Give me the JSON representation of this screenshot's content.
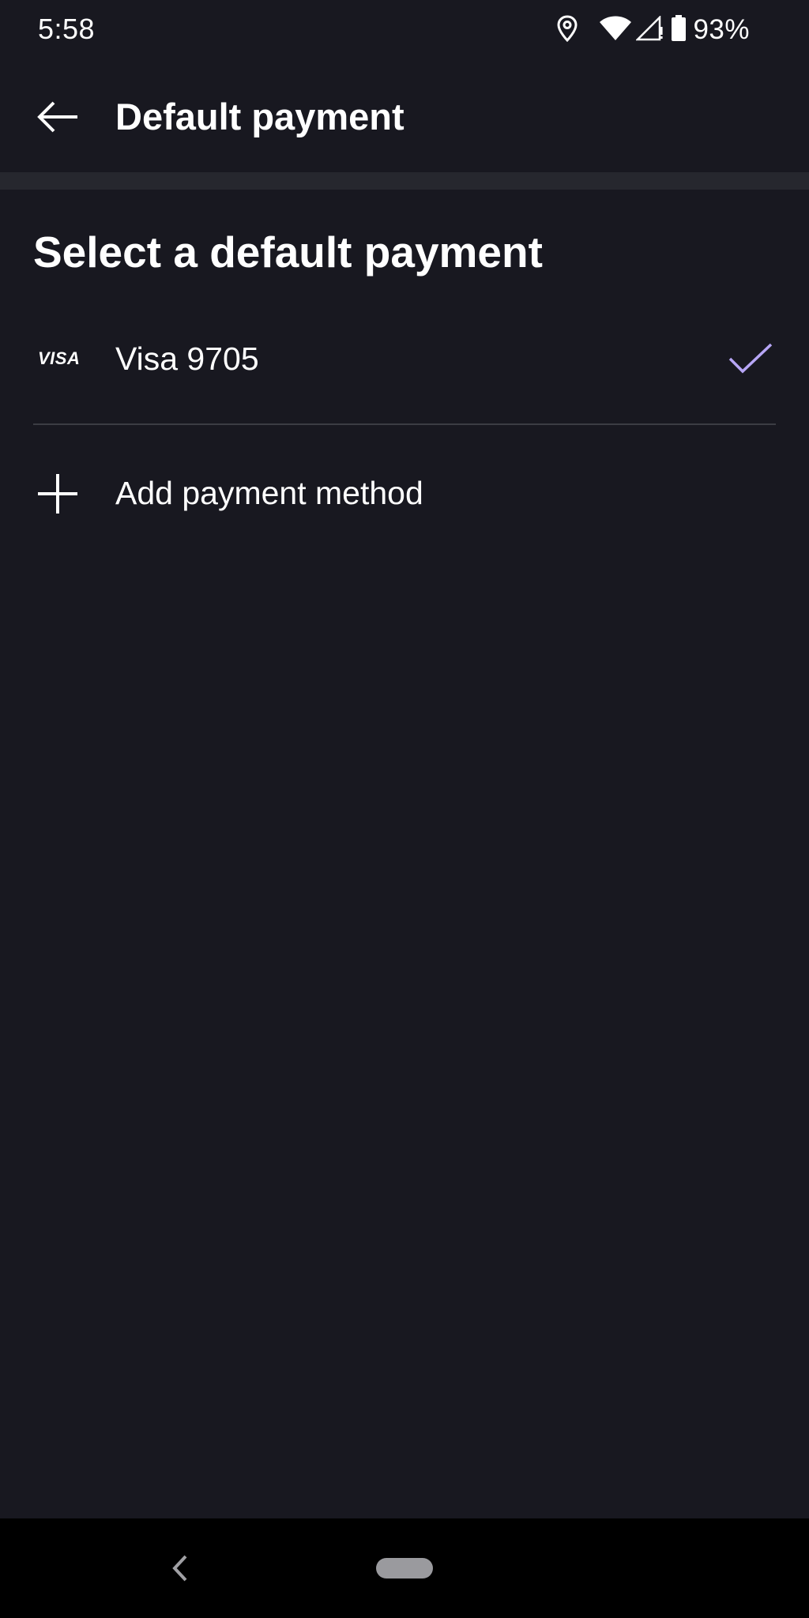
{
  "status_bar": {
    "time": "5:58",
    "battery": "93%",
    "icons": [
      "location-icon",
      "wifi-icon",
      "signal-icon",
      "battery-icon"
    ]
  },
  "app_bar": {
    "title": "Default payment",
    "back_icon": "arrow-left-icon"
  },
  "content": {
    "heading": "Select a default payment",
    "payment_methods": [
      {
        "brand": "VISA",
        "label": "Visa 9705",
        "selected": true
      }
    ],
    "add_label": "Add payment method"
  },
  "nav_bar": {
    "icons": [
      "nav-back-icon",
      "home-pill-icon"
    ]
  },
  "colors": {
    "background": "#181820",
    "divider_band": "#26272e",
    "divider_line": "#3b3c43",
    "accent_check": "#b7a6f6",
    "nav_background": "#000000",
    "text": "#ffffff"
  }
}
